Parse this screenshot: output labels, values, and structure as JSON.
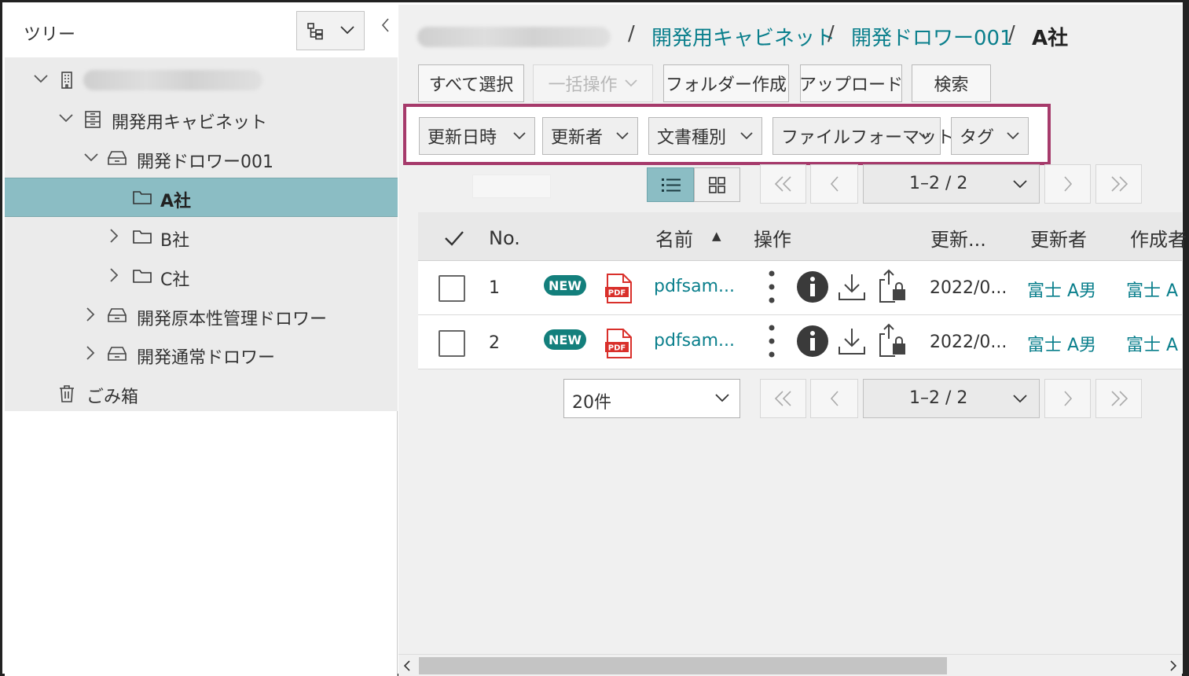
{
  "tree": {
    "title": "ツリー",
    "collapse_icon": "chevron-left-icon",
    "items": [
      {
        "label": "",
        "redacted": true,
        "icon": "building-icon",
        "expanded": true
      },
      {
        "label": "開発用キャビネット",
        "icon": "cabinet-icon",
        "expanded": true
      },
      {
        "label": "開発ドロワー001",
        "icon": "drawer-icon",
        "expanded": true
      },
      {
        "label": "A社",
        "icon": "folder-icon",
        "selected": true
      },
      {
        "label": "B社",
        "icon": "folder-icon",
        "expanded": false
      },
      {
        "label": "C社",
        "icon": "folder-icon",
        "expanded": false
      },
      {
        "label": "開発原本性管理ドロワー",
        "icon": "drawer-icon",
        "expanded": false
      },
      {
        "label": "開発通常ドロワー",
        "icon": "drawer-icon",
        "expanded": false
      },
      {
        "label": "ごみ箱",
        "icon": "trash-icon"
      }
    ]
  },
  "breadcrumb": {
    "items": [
      "開発用キャビネット",
      "開発ドロワー001"
    ],
    "current": "A社",
    "separator": "/"
  },
  "toolbar": {
    "select_all": "すべて選択",
    "bulk_action": "一括操作",
    "create_folder": "フォルダー作成",
    "upload": "アップロード",
    "search": "検索"
  },
  "filters": [
    "更新日時",
    "更新者",
    "文書種別",
    "ファイルフォーマット",
    "タグ"
  ],
  "pagination": {
    "range_label": "1–2 / 2",
    "per_page": "20件"
  },
  "table": {
    "headers": {
      "no": "No.",
      "name": "名前",
      "sort_indicator": "▲",
      "actions": "操作",
      "updated_at": "更新...",
      "updated_by": "更新者",
      "created_by": "作成者"
    },
    "rows": [
      {
        "no": "1",
        "badge": "NEW",
        "file_icon_label": "PDF",
        "name": "pdfsam...",
        "updated_at": "2022/0...",
        "updated_by": "富士 A男",
        "created_by": "富士 A"
      },
      {
        "no": "2",
        "badge": "NEW",
        "file_icon_label": "PDF",
        "name": "pdfsam...",
        "updated_at": "2022/0...",
        "updated_by": "富士 A男",
        "created_by": "富士 A"
      }
    ]
  },
  "colors": {
    "accent_teal": "#0a7f8c",
    "selected_row": "#8bbdc4",
    "filter_highlight": "#a63a6b",
    "new_badge": "#137f7c",
    "pdf_red": "#d9302b"
  }
}
